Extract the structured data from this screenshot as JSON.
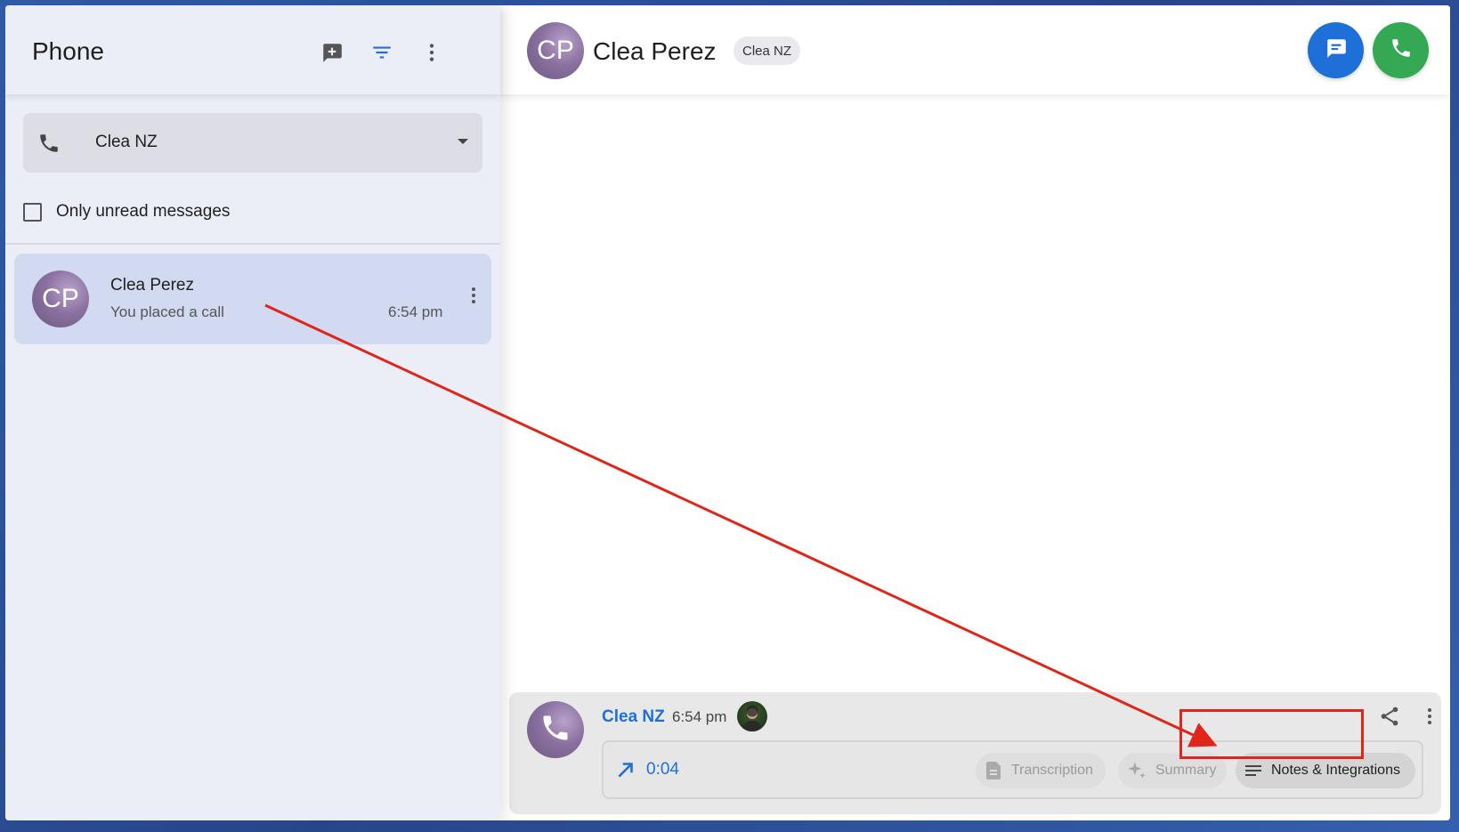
{
  "app": {
    "title": "Phone"
  },
  "header_icons": [
    "new-message-icon",
    "filter-icon",
    "more-vert-icon"
  ],
  "line_selector": {
    "value": "Clea NZ",
    "icon": "phone-icon"
  },
  "filter": {
    "unread_label": "Only unread messages",
    "checked": false
  },
  "conversations": [
    {
      "initials": "CP",
      "name": "Clea Perez",
      "preview": "You placed a call",
      "time": "6:54 pm"
    }
  ],
  "contact": {
    "initials": "CP",
    "name": "Clea Perez",
    "line_chip": "Clea NZ"
  },
  "actions": {
    "message_icon": "chat-icon",
    "call_icon": "phone-icon",
    "colors": {
      "message": "#1f6fd8",
      "call": "#35a853"
    }
  },
  "call_entry": {
    "line": "Clea NZ",
    "time": "6:54 pm",
    "duration": "0:04",
    "direction": "outgoing",
    "buttons": {
      "transcription": "Transcription",
      "summary": "Summary",
      "notes": "Notes & Integrations"
    }
  },
  "annotation": {
    "color": "#e0261b",
    "target": "Notes & Integrations"
  }
}
